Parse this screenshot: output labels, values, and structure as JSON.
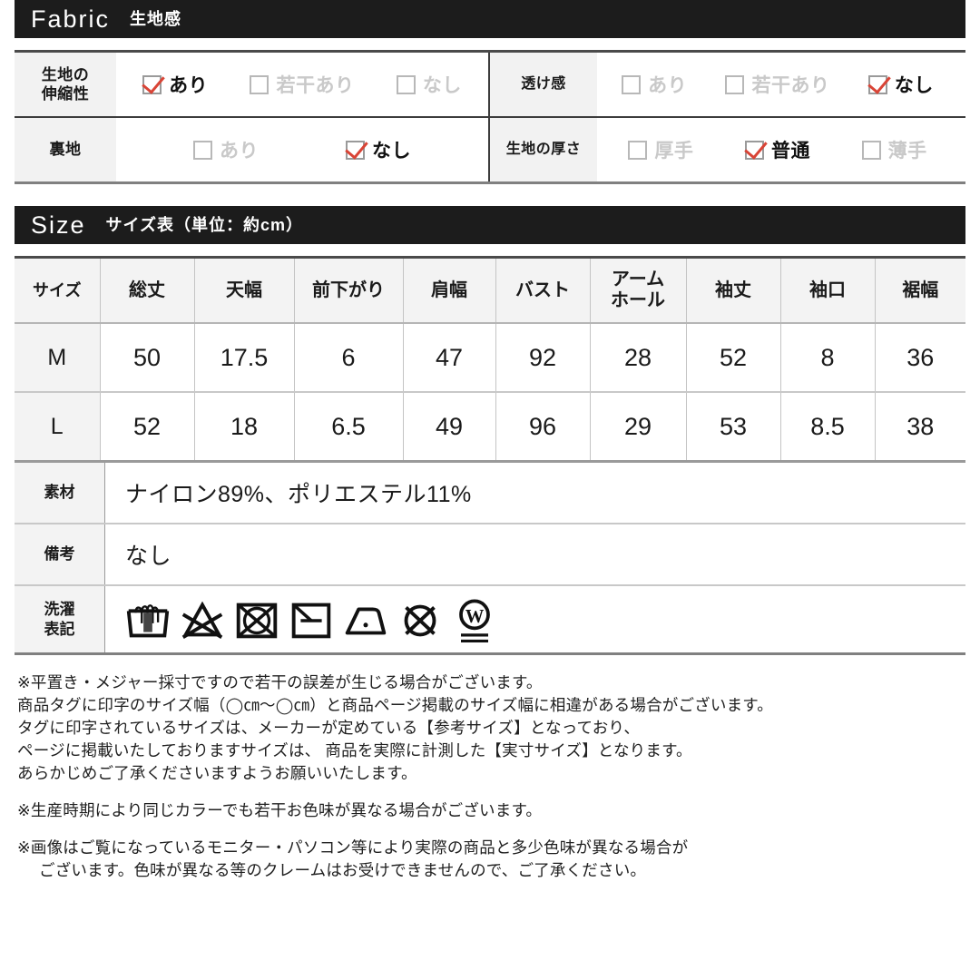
{
  "fabric_section": {
    "en_title": "Fabric",
    "jp_title": "生地感",
    "rows": [
      {
        "label": "生地の\n伸縮性",
        "options": [
          {
            "label": "あり",
            "checked": true
          },
          {
            "label": "若干あり",
            "checked": false
          },
          {
            "label": "なし",
            "checked": false
          }
        ]
      },
      {
        "label": "透け感",
        "options": [
          {
            "label": "あり",
            "checked": false
          },
          {
            "label": "若干あり",
            "checked": false
          },
          {
            "label": "なし",
            "checked": true
          }
        ]
      },
      {
        "label": "裏地",
        "options": [
          {
            "label": "あり",
            "checked": false
          },
          {
            "label": "なし",
            "checked": true
          }
        ]
      },
      {
        "label": "生地の厚さ",
        "options": [
          {
            "label": "厚手",
            "checked": false
          },
          {
            "label": "普通",
            "checked": true
          },
          {
            "label": "薄手",
            "checked": false
          }
        ]
      }
    ]
  },
  "size_section": {
    "en_title": "Size",
    "jp_title": "サイズ表（単位：約cm）",
    "headers": [
      "サイズ",
      "総丈",
      "天幅",
      "前下がり",
      "肩幅",
      "バスト",
      "アーム\nホール",
      "袖丈",
      "袖口",
      "裾幅"
    ],
    "rows": [
      {
        "size": "M",
        "values": [
          "50",
          "17.5",
          "6",
          "47",
          "92",
          "28",
          "52",
          "8",
          "36"
        ]
      },
      {
        "size": "L",
        "values": [
          "52",
          "18",
          "6.5",
          "49",
          "96",
          "29",
          "53",
          "8.5",
          "38"
        ]
      }
    ],
    "info": [
      {
        "label": "素材",
        "value": "ナイロン89%、ポリエステル11%"
      },
      {
        "label": "備考",
        "value": "なし"
      }
    ],
    "care_label": "洗濯\n表記",
    "care_icons": [
      "hand-wash-icon",
      "no-bleach-icon",
      "no-tumble-dry-icon",
      "drip-dry-in-shade-icon",
      "iron-low-icon",
      "no-dry-clean-icon",
      "wet-clean-gentle-icon"
    ]
  },
  "notes": {
    "block1": [
      "※平置き・メジャー採寸ですので若干の誤差が生じる場合がございます。",
      "商品タグに印字のサイズ幅（◯㎝〜◯㎝）と商品ページ掲載のサイズ幅に相違がある場合がございます。",
      "タグに印字されているサイズは、メーカーが定めている【参考サイズ】となっており、",
      "ページに掲載いたしておりますサイズは、 商品を実際に計測した【実寸サイズ】となります。",
      "あらかじめご了承くださいますようお願いいたします。"
    ],
    "block2": [
      "※生産時期により同じカラーでも若干お色味が異なる場合がございます。"
    ],
    "block3_line1": "※画像はご覧になっているモニター・パソコン等により実際の商品と多少色味が異なる場合が",
    "block3_line2": "ございます。色味が異なる等のクレームはお受けできませんので、ご了承ください。"
  },
  "colors": {
    "header_bg": "#1c1c1c",
    "check_red": "#d94436",
    "label_bg": "#f3f3f3"
  }
}
